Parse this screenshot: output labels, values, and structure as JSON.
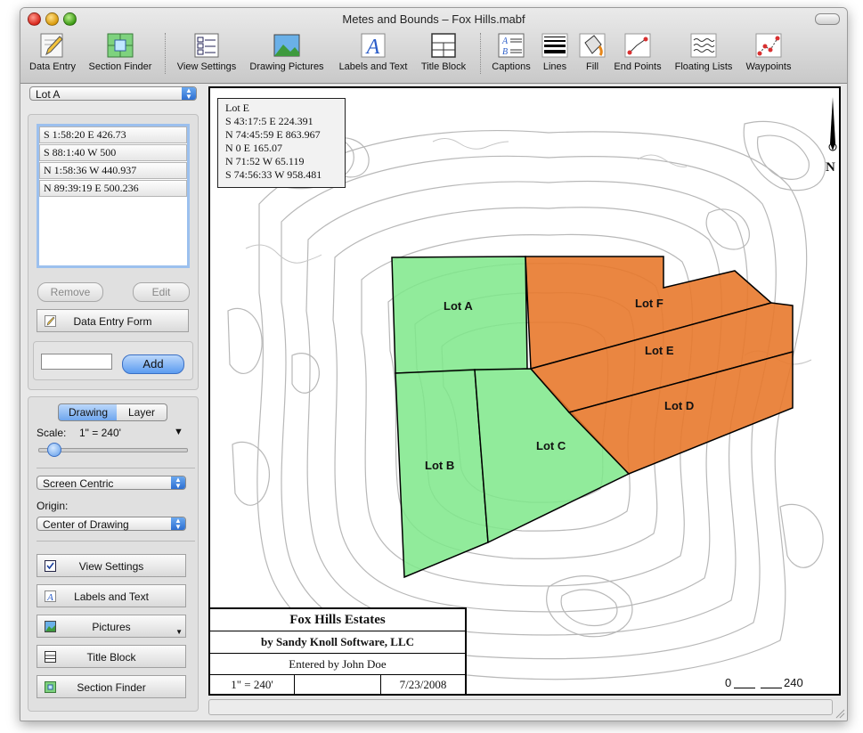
{
  "window": {
    "title": "Metes and Bounds – Fox Hills.mabf"
  },
  "toolbar": {
    "items": [
      {
        "label": "Data Entry",
        "icon": "pencil-icon"
      },
      {
        "label": "Section Finder",
        "icon": "section-finder-icon"
      },
      {
        "label": "View Settings",
        "icon": "checklist-icon"
      },
      {
        "label": "Drawing Pictures",
        "icon": "picture-icon"
      },
      {
        "label": "Labels and Text",
        "icon": "letter-a-icon"
      },
      {
        "label": "Title Block",
        "icon": "title-block-icon"
      },
      {
        "label": "Captions",
        "icon": "captions-icon"
      },
      {
        "label": "Lines",
        "icon": "lines-icon"
      },
      {
        "label": "Fill",
        "icon": "paint-bucket-icon"
      },
      {
        "label": "End Points",
        "icon": "end-points-icon"
      },
      {
        "label": "Floating Lists",
        "icon": "floating-lists-icon"
      },
      {
        "label": "Waypoints",
        "icon": "waypoints-icon"
      }
    ]
  },
  "sidebar": {
    "lot_select": "Lot A",
    "calls": [
      "S 1:58:20 E 426.73",
      "S 88:1:40 W 500",
      "N 1:58:36 W 440.937",
      "N 89:39:19 E 500.236"
    ],
    "remove_label": "Remove",
    "edit_label": "Edit",
    "data_entry_form_label": "Data Entry Form",
    "add_input_value": "",
    "add_label": "Add",
    "tabs": [
      "Drawing",
      "Layer"
    ],
    "active_tab": "Drawing",
    "scale_label": "Scale:",
    "scale_value": "1\" = 240'",
    "view_mode": "Screen Centric",
    "origin_label": "Origin:",
    "origin_value": "Center of Drawing",
    "buttons": [
      "View Settings",
      "Labels and Text",
      "Pictures",
      "Title Block",
      "Section Finder"
    ]
  },
  "drawing": {
    "callout": {
      "title": "Lot E",
      "lines": [
        "S 43:17:5 E 224.391",
        "N 74:45:59 E 863.967",
        "N 0 E 165.07",
        "N 71:52 W 65.119",
        "S 74:56:33 W 958.481"
      ]
    },
    "lots": [
      {
        "name": "Lot A",
        "color": "#7ee88a"
      },
      {
        "name": "Lot B",
        "color": "#7ee88a"
      },
      {
        "name": "Lot C",
        "color": "#7ee88a"
      },
      {
        "name": "Lot D",
        "color": "#e8792c"
      },
      {
        "name": "Lot E",
        "color": "#e8792c"
      },
      {
        "name": "Lot F",
        "color": "#e8792c"
      }
    ],
    "north_label": "N",
    "title_block": {
      "title": "Fox Hills Estates",
      "company": "by Sandy Knoll Software, LLC",
      "entered_by": "Entered by John Doe",
      "scale": "1\" = 240'",
      "middle": "",
      "date": "7/23/2008"
    },
    "scale_bar": {
      "start": "0",
      "end": "240"
    }
  },
  "colors": {
    "green_lot": "#7ee88a",
    "orange_lot": "#e8792c",
    "accent": "#3d86e8"
  }
}
